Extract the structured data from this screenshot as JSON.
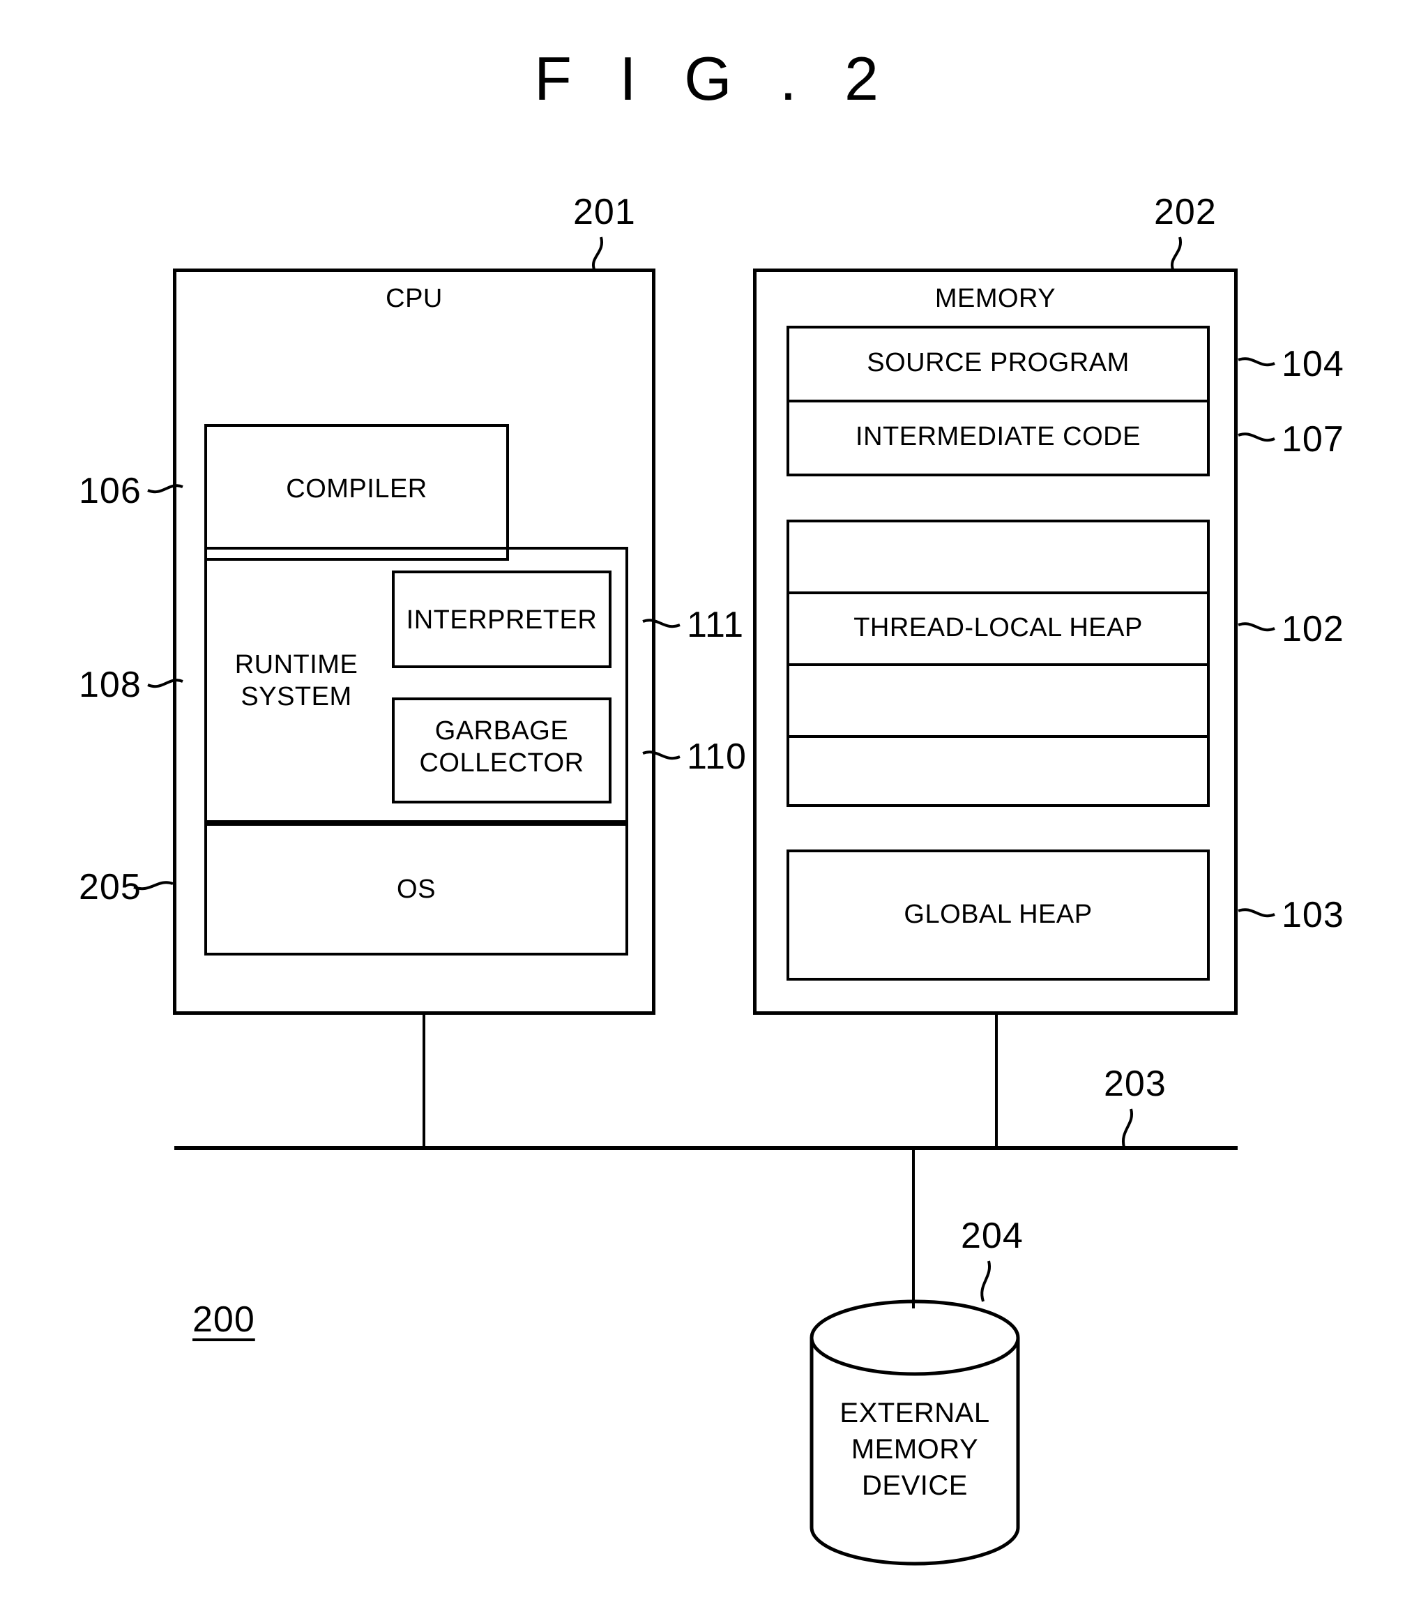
{
  "figure": {
    "title": "F I G . 2",
    "system_ref": "200"
  },
  "cpu": {
    "title": "CPU",
    "ref": "201",
    "compiler": {
      "label": "COMPILER",
      "ref": "106"
    },
    "runtime_system": {
      "label": "RUNTIME\nSYSTEM",
      "ref": "108"
    },
    "interpreter": {
      "label": "INTERPRETER",
      "ref": "111"
    },
    "garbage_collector": {
      "label": "GARBAGE\nCOLLECTOR",
      "ref": "110"
    },
    "os": {
      "label": "OS",
      "ref": "205"
    }
  },
  "memory": {
    "title": "MEMORY",
    "ref": "202",
    "source_program": {
      "label": "SOURCE PROGRAM",
      "ref": "104"
    },
    "intermediate_code": {
      "label": "INTERMEDIATE CODE",
      "ref": "107"
    },
    "thread_local_heap": {
      "label": "THREAD-LOCAL HEAP",
      "ref": "102",
      "slot_count": 4,
      "labeled_slot_index": 2
    },
    "global_heap": {
      "label": "GLOBAL HEAP",
      "ref": "103"
    }
  },
  "bus": {
    "ref": "203"
  },
  "external_memory_device": {
    "label": "EXTERNAL\nMEMORY\nDEVICE",
    "ref": "204"
  },
  "colors": {
    "stroke": "#000000",
    "background": "#ffffff"
  }
}
